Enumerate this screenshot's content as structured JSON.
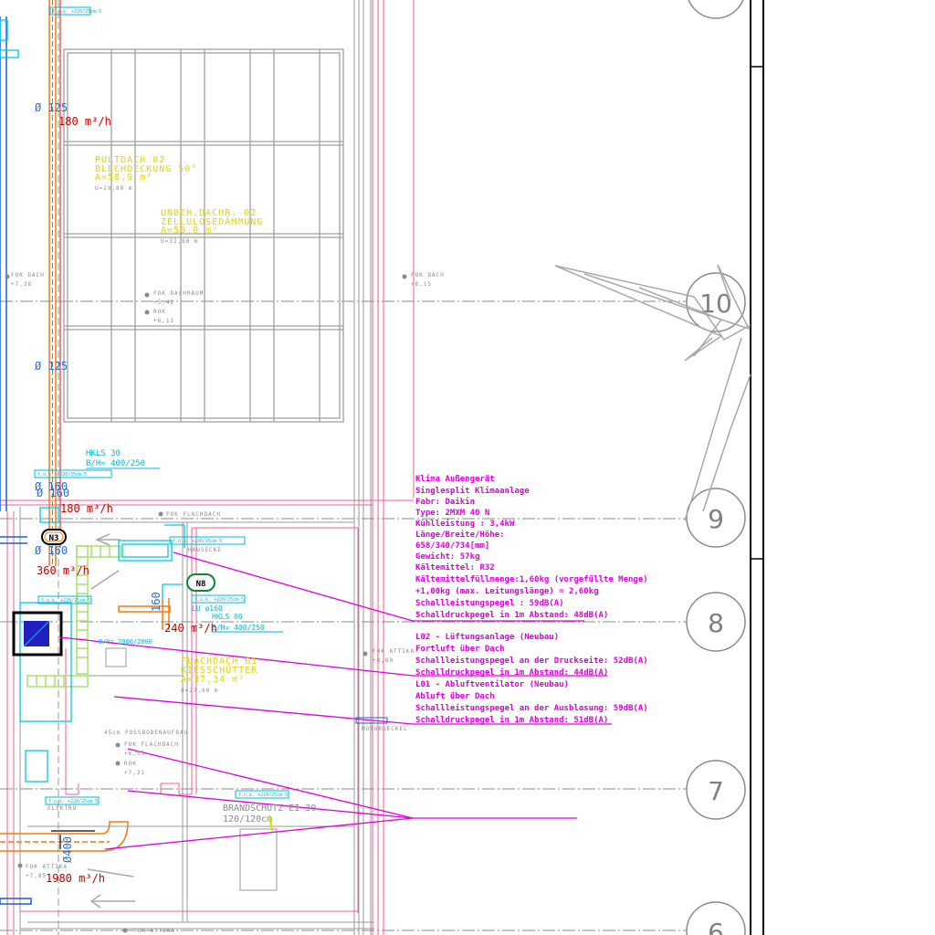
{
  "axes": [
    {
      "label": "10"
    },
    {
      "label": "9"
    },
    {
      "label": "8"
    },
    {
      "label": "7"
    },
    {
      "label": "6"
    }
  ],
  "roof_labels": {
    "pultdach_title": "PULTDACH 02",
    "pultdach_sub": "BLECHDECKUNG 50°",
    "pultdach_sub2": "A=58,9 m²",
    "pultdach_u": "U=29,80 m",
    "unbeh_title": "UNBEH.DACHR. 02",
    "unbeh_sub": "ZELLULOSEDÄMMUNG",
    "unbeh_sub2": "A=50,0 m²",
    "unbeh_u": "U=32,80 m",
    "flachdach_title": "FLACHDACH 01",
    "flachdach_sub": "KIESSCHÜTTER",
    "flachdach_sub2": "A=37,34 m²",
    "flachdach_u": "U=27,60 m"
  },
  "levels": {
    "fok_dach_left": "FOK DACH",
    "fok_dach_left_val": "+7,38",
    "fok_dach_right": "FOK DACH",
    "fok_dach_right_val": "+8,15",
    "fok_dachraum": "FOK DACHRAUM",
    "fok_dachraum_val": "+5,42",
    "rok_top": "ROK",
    "rok_top_val": "+6,11",
    "fok_attika_mid": "FOK ATTIKA",
    "fok_attika_mid_val": "+8,60",
    "fok_flachdach": "FOK FLACHDACH",
    "fok_flachdach_val": "+6,55",
    "rok_bottom": "ROK",
    "rok_bottom_val": "+7,21",
    "fussbodenaufbau": "45cm FUSSBODENAUFBAU",
    "fok_attika_low": "FOK ATTIKA",
    "fok_attika_low_val": "+7,85",
    "fok_attika_bottom": "FOK ATTIKA",
    "fok_flachdach_top": "FOK FLACHDACH",
    "hausecke": "HAUSECKE",
    "elektro": "ELEKTRO",
    "motordeckel": "MOTORDECKEL"
  },
  "ducts": {
    "d125_top": "Ø 125",
    "flow_180_top": "180 m³/h",
    "d125_mid": "Ø 125",
    "d160_a": "Ø 160",
    "d160_b": "Ø 160",
    "flow_180_mid": "180 m³/h",
    "d160_c": "Ø 160",
    "flow_360": "360 m³/h",
    "flow_240": "240 m³/h",
    "d160_vert": "160",
    "flow_1980": "1980 m³/h",
    "d400": "Ø400",
    "hkls_title": "HKLS 30",
    "hkls_sub": "B/H= 400/250",
    "lu": "LU ø160",
    "hkls_small": "HKLS 00",
    "hkls_small_sub": "B/H= 400/250",
    "bh_2000": "B/H= 2000/2000",
    "air_tag": "f.o.k. +220/25cm·5"
  },
  "equipment": {
    "n3": "N3",
    "n8": "N8"
  },
  "fire": {
    "title": "BRANDSCHUTZ EI 30",
    "size": "120/120cm"
  },
  "note_klima": [
    "Klima Außengerät",
    "Singlesplit Klimaanlage",
    "Fabr: Daikin",
    "Type: 2MXM 40 N",
    "Kühlleistung : 3,4kW",
    "Länge/Breite/Höhe:",
    "658/340/734[mm]",
    "Gewicht: 57kg",
    "Kältemittel: R32",
    "Kältemittelfüllmenge:1,60kg (vorgefüllte Menge)",
    "+1,00kg (max. Leitungslänge) = 2,60kg",
    "Schallleistungspegel : 59dB(A)",
    "Schalldruckpegel in 1m Abstand: 48dB(A)"
  ],
  "note_lueftung": [
    "L02 - Lüftungsanlage (Neubau)",
    "Fortluft über Dach",
    "Schallleistungspegel an der Druckseite: 52dB(A)",
    "Schalldruckpegel in 1m Abstand: 44dB(A)",
    "L01 - Abluftventilator (Neubau)",
    "Abluft über Dach",
    "Schallleistungspegel an der Ausblasung: 59dB(A)",
    "Schalldruckpegel in 1m Abstand: 51dB(A)"
  ],
  "colors": {
    "magenta": "#e000e0",
    "pink": "#f06090",
    "orange": "#f07a10",
    "cyan": "#00c8e8",
    "blue": "#1c5fd0",
    "green": "#a8e070",
    "grey": "#9a9a9a",
    "dark_red": "#c00000",
    "yellow": "#e6d200"
  }
}
